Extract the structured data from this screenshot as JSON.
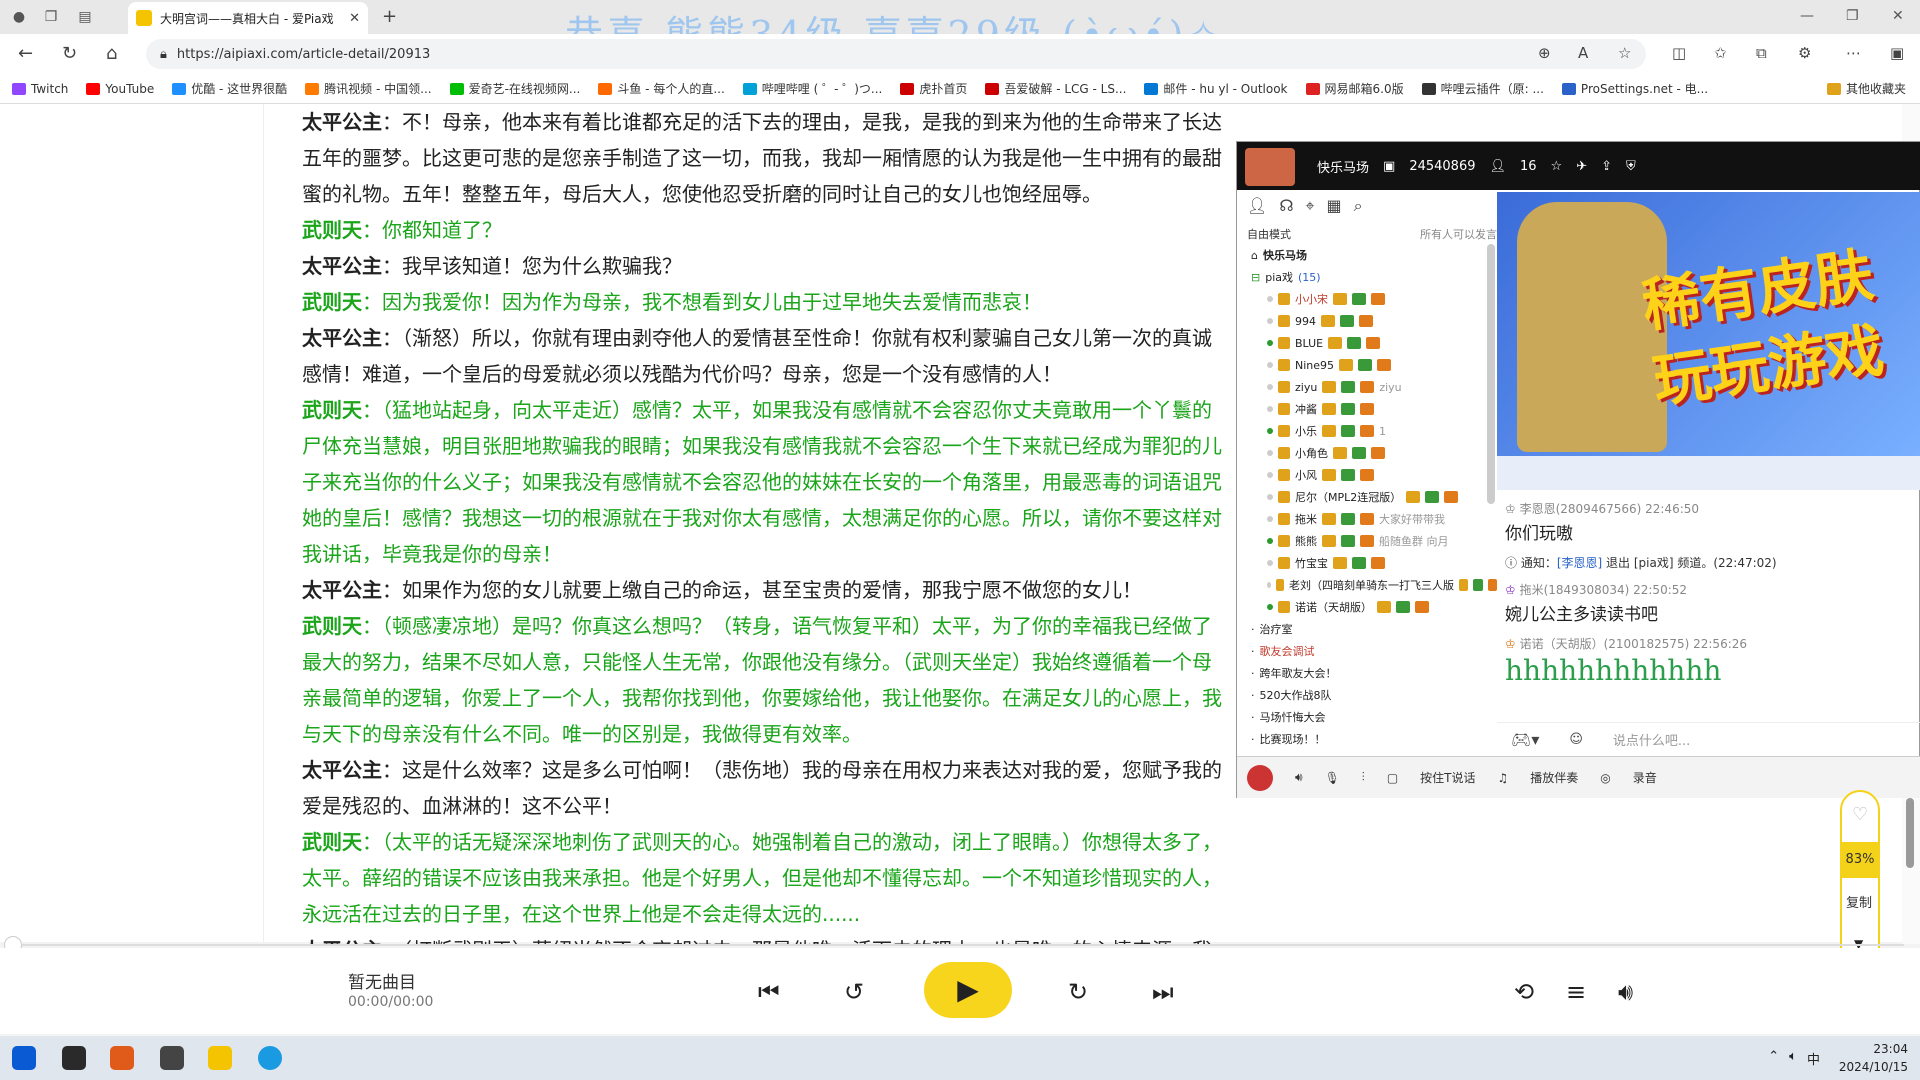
{
  "browser": {
    "tab_title": "大明宫词——真相大白 - 爱Pia戏",
    "url": "https://aipiaxi.com/article-detail/20913",
    "banner_text": "恭喜 熊熊34级 嘉嘉29级 (•̀ω•́)✧"
  },
  "bookmarks": [
    {
      "label": "Twitch",
      "color": "#9146ff"
    },
    {
      "label": "YouTube",
      "color": "#ff0000"
    },
    {
      "label": "优酷 - 这世界很酷",
      "color": "#1e90ff"
    },
    {
      "label": "腾讯视频 - 中国领...",
      "color": "#ff7a00"
    },
    {
      "label": "爱奇艺-在线视频网...",
      "color": "#00be06"
    },
    {
      "label": "斗鱼 - 每个人的直...",
      "color": "#ff6a00"
    },
    {
      "label": "哔哩哔哩 ( ゜- ゜)つ...",
      "color": "#00a1d6"
    },
    {
      "label": "虎扑首页",
      "color": "#c00"
    },
    {
      "label": "吾爱破解 - LCG - LS...",
      "color": "#c00"
    },
    {
      "label": "邮件 - hu yl - Outlook",
      "color": "#0078d4"
    },
    {
      "label": "网易邮箱6.0版",
      "color": "#d22"
    },
    {
      "label": "哔哩云插件（原: ...",
      "color": "#333"
    },
    {
      "label": "ProSettings.net - 电...",
      "color": "#2a62c8"
    },
    {
      "label": "其他收藏夹",
      "color": "#e0a21a"
    }
  ],
  "article": [
    {
      "s": "太平公主",
      "t": "：不！母亲，他本来有着比谁都充足的活下去的理由，是我，是我的到来为他的生命带来了长达五年的噩梦。比这更可悲的是您亲手制造了这一切，而我，我却一厢情愿的认为我是他一生中拥有的最甜蜜的礼物。五年！整整五年，母后大人，您使他忍受折磨的同时让自己的女儿也饱经屈辱。",
      "c": "s1"
    },
    {
      "s": "武则天",
      "t": "：你都知道了？",
      "c": "s2"
    },
    {
      "s": "太平公主",
      "t": "：我早该知道！您为什么欺骗我？",
      "c": "s1"
    },
    {
      "s": "武则天",
      "t": "：因为我爱你！因为作为母亲，我不想看到女儿由于过早地失去爱情而悲哀！",
      "c": "s2"
    },
    {
      "s": "太平公主",
      "t": "：（渐怒）所以，你就有理由剥夺他人的爱情甚至性命！你就有权利蒙骗自己女儿第一次的真诚感情！难道，一个皇后的母爱就必须以残酷为代价吗？母亲，您是一个没有感情的人！",
      "c": "s1"
    },
    {
      "s": "武则天",
      "t": "：（猛地站起身，向太平走近）感情？太平，如果我没有感情就不会容忍你丈夫竟敢用一个丫鬟的尸体充当慧娘，明目张胆地欺骗我的眼睛；如果我没有感情我就不会容忍一个生下来就已经成为罪犯的儿子来充当你的什么义子；如果我没有感情就不会容忍他的妹妹在长安的一个角落里，用最恶毒的词语诅咒她的皇后！感情？我想这一切的根源就在于我对你太有感情，太想满足你的心愿。所以，请你不要这样对我讲话，毕竟我是你的母亲！",
      "c": "s2"
    },
    {
      "s": "太平公主",
      "t": "：如果作为您的女儿就要上缴自己的命运，甚至宝贵的爱情，那我宁愿不做您的女儿！",
      "c": "s1"
    },
    {
      "s": "武则天",
      "t": "：（顿感凄凉地）是吗？你真这么想吗？（转身，语气恢复平和）太平，为了你的幸福我已经做了最大的努力，结果不尽如人意，只能怪人生无常，你跟他没有缘分。（武则天坐定）我始终遵循着一个母亲最简单的逻辑，你爱上了一个人，我帮你找到他，你要嫁给他，我让他娶你。在满足女儿的心愿上，我与天下的母亲没有什么不同。唯一的区别是，我做得更有效率。",
      "c": "s2"
    },
    {
      "s": "太平公主",
      "t": "：这是什么效率？这是多么可怕啊！（悲伤地）我的母亲在用权力来表达对我的爱，您赋予我的爱是残忍的、血淋淋的！这不公平！",
      "c": "s1"
    },
    {
      "s": "武则天",
      "t": "：（太平的话无疑深深地刺伤了武则天的心。她强制着自己的激动，闭上了眼睛。）你想得太多了，太平。薛绍的错误不应该由我来承担。他是个好男人，但是他却不懂得忘却。一个不知道珍惜现实的人，永远活在过去的日子里，在这个世界上他是不会走得太远的......",
      "c": "s2"
    },
    {
      "s": "太平公主",
      "t": "：（打断武则天）薛绍当然不会忘却过去，那是他唯一活下去的理由，也是唯一的心情来源，我",
      "c": "s1"
    }
  ],
  "chat": {
    "room_name": "快乐马场",
    "room_id": "24540869",
    "user_count": "16",
    "mode_left": "自由模式",
    "mode_right": "所有人可以发言",
    "channel_root": "快乐马场",
    "channel_pia": "pia戏",
    "channel_pia_count": "(15)",
    "users": [
      {
        "name": "小小宋",
        "extra": "",
        "color": "#c0392b",
        "on": false
      },
      {
        "name": "994",
        "extra": "",
        "color": "#222",
        "on": false
      },
      {
        "name": "BLUE",
        "extra": "",
        "color": "#222",
        "on": true
      },
      {
        "name": "Nine95",
        "extra": "",
        "color": "#222",
        "on": false
      },
      {
        "name": "ziyu",
        "extra": "ziyu",
        "color": "#222",
        "on": false
      },
      {
        "name": "冲酱",
        "extra": "",
        "color": "#222",
        "on": false
      },
      {
        "name": "小乐",
        "extra": "1",
        "color": "#222",
        "on": true
      },
      {
        "name": "小角色",
        "extra": "",
        "color": "#222",
        "on": false
      },
      {
        "name": "小风",
        "extra": "",
        "color": "#222",
        "on": false
      },
      {
        "name": "尼尔（MPL2连冠版）",
        "extra": "",
        "color": "#222",
        "on": false
      },
      {
        "name": "拖米",
        "extra": "大家好带带我",
        "color": "#222",
        "on": false
      },
      {
        "name": "熊熊",
        "extra": "船随鱼群 向月",
        "color": "#222",
        "on": true
      },
      {
        "name": "竹宝宝",
        "extra": "",
        "color": "#222",
        "on": false
      },
      {
        "name": "老刘（四暗刻单骑东一打飞三人版",
        "extra": "",
        "color": "#222",
        "on": false
      },
      {
        "name": "诺诺（天胡版）",
        "extra": "",
        "color": "#222",
        "on": true
      }
    ],
    "channels": [
      {
        "name": "治疗室",
        "color": "#222"
      },
      {
        "name": "歌友会调试",
        "color": "#c0392b"
      },
      {
        "name": "跨年歌友大会！",
        "color": "#222"
      },
      {
        "name": "520大作战8队",
        "color": "#222"
      },
      {
        "name": "马场忏悔大会",
        "color": "#222"
      },
      {
        "name": "比赛现场！！",
        "color": "#222"
      }
    ],
    "messages": [
      {
        "meta": "李恩恩(2809467566)  22:46:50",
        "text": "你们玩嗷"
      },
      {
        "meta": "拖米(1849308034)  22:50:52",
        "text": "婉儿公主多读读书吧"
      },
      {
        "meta": "诺诺（天胡版）(2100182575)  22:56:26",
        "text": "hhhhhhhhhhhh"
      }
    ],
    "notice_prefix": "通知：",
    "notice_user": "[李恩恩]",
    "notice_rest": " 退出 [pia戏] 频道。(22:47:02)",
    "input_placeholder": "说点什么吧...",
    "bottom_ptt": "按住T说话",
    "bottom_music": "播放伴奏",
    "bottom_record": "录音",
    "promo_line1": "稀有皮肤",
    "promo_line2": "玩玩游戏"
  },
  "rail": {
    "percent": "83%",
    "label": "复制"
  },
  "player": {
    "song": "暂无曲目",
    "time": "00:00/00:00"
  },
  "taskbar": {
    "time": "23:04",
    "date": "2024/10/15",
    "ime": "中"
  }
}
